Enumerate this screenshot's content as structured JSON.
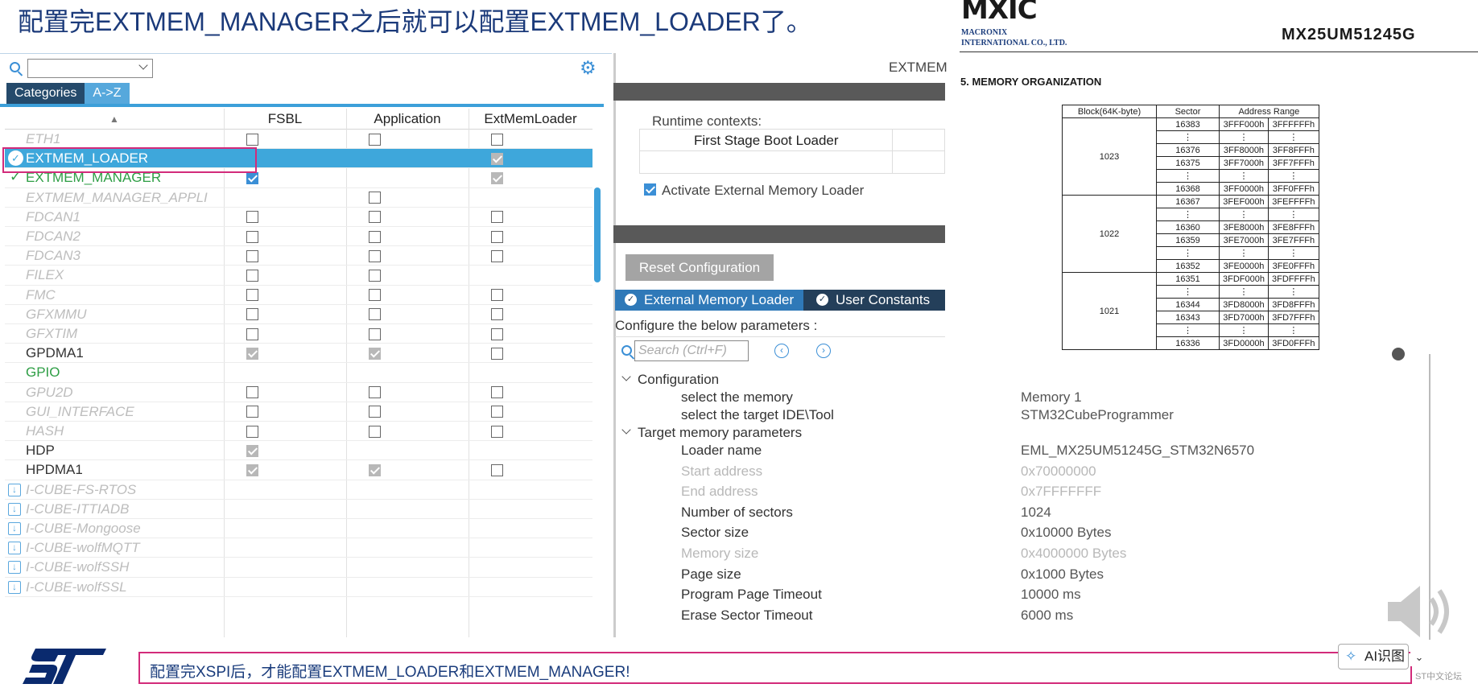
{
  "slide": {
    "title": "配置完EXTMEM_MANAGER之后就可以配置EXTMEM_LOADER了。",
    "footer_note": "配置完XSPI后，才能配置EXTMEM_LOADER和EXTMEM_MANAGER!"
  },
  "left_panel": {
    "search_value": "",
    "tabs": [
      "Categories",
      "A->Z"
    ],
    "active_tab": "A->Z",
    "columns": [
      "FSBL",
      "Application",
      "ExtMemLoader"
    ],
    "rows": [
      {
        "name": "ETH1",
        "state": "disabled",
        "fsbl": "off",
        "app": "off",
        "eml": "off"
      },
      {
        "name": "EXTMEM_LOADER",
        "state": "selected",
        "fsbl": "none",
        "app": "none",
        "eml": "locked"
      },
      {
        "name": "EXTMEM_MANAGER",
        "state": "ok",
        "fsbl": "on",
        "app": "none",
        "eml": "locked"
      },
      {
        "name": "EXTMEM_MANAGER_APPLI",
        "state": "disabled",
        "fsbl": "none",
        "app": "off",
        "eml": "none"
      },
      {
        "name": "FDCAN1",
        "state": "disabled",
        "fsbl": "off",
        "app": "off",
        "eml": "off"
      },
      {
        "name": "FDCAN2",
        "state": "disabled",
        "fsbl": "off",
        "app": "off",
        "eml": "off"
      },
      {
        "name": "FDCAN3",
        "state": "disabled",
        "fsbl": "off",
        "app": "off",
        "eml": "off"
      },
      {
        "name": "FILEX",
        "state": "disabled",
        "fsbl": "off",
        "app": "off",
        "eml": "none"
      },
      {
        "name": "FMC",
        "state": "disabled",
        "fsbl": "off",
        "app": "off",
        "eml": "off"
      },
      {
        "name": "GFXMMU",
        "state": "disabled",
        "fsbl": "off",
        "app": "off",
        "eml": "off"
      },
      {
        "name": "GFXTIM",
        "state": "disabled",
        "fsbl": "off",
        "app": "off",
        "eml": "off"
      },
      {
        "name": "GPDMA1",
        "state": "enabled",
        "fsbl": "locked",
        "app": "locked",
        "eml": "off"
      },
      {
        "name": "GPIO",
        "state": "ok-text",
        "fsbl": "none",
        "app": "none",
        "eml": "none"
      },
      {
        "name": "GPU2D",
        "state": "disabled",
        "fsbl": "off",
        "app": "off",
        "eml": "off"
      },
      {
        "name": "GUI_INTERFACE",
        "state": "disabled",
        "fsbl": "off",
        "app": "off",
        "eml": "off"
      },
      {
        "name": "HASH",
        "state": "disabled",
        "fsbl": "off",
        "app": "off",
        "eml": "off"
      },
      {
        "name": "HDP",
        "state": "enabled",
        "fsbl": "locked",
        "app": "none",
        "eml": "none"
      },
      {
        "name": "HPDMA1",
        "state": "enabled",
        "fsbl": "locked",
        "app": "locked",
        "eml": "off"
      },
      {
        "name": "I-CUBE-FS-RTOS",
        "state": "pack",
        "fsbl": "none",
        "app": "none",
        "eml": "none"
      },
      {
        "name": "I-CUBE-ITTIADB",
        "state": "pack",
        "fsbl": "none",
        "app": "none",
        "eml": "none"
      },
      {
        "name": "I-CUBE-Mongoose",
        "state": "pack",
        "fsbl": "none",
        "app": "none",
        "eml": "none"
      },
      {
        "name": "I-CUBE-wolfMQTT",
        "state": "pack",
        "fsbl": "none",
        "app": "none",
        "eml": "none"
      },
      {
        "name": "I-CUBE-wolfSSH",
        "state": "pack",
        "fsbl": "none",
        "app": "none",
        "eml": "none"
      },
      {
        "name": "I-CUBE-wolfSSL",
        "state": "pack",
        "fsbl": "none",
        "app": "none",
        "eml": "none"
      }
    ]
  },
  "mid_panel": {
    "header": "EXTMEM",
    "runtime_label": "Runtime contexts:",
    "runtime_context": "First Stage Boot Loader",
    "activate_label": "Activate External Memory Loader",
    "activate_checked": true,
    "reset_button": "Reset Configuration",
    "tabs": [
      "External Memory Loader",
      "User Constants"
    ],
    "configure_note": "Configure the below parameters :",
    "search_placeholder": "Search (Ctrl+F)"
  },
  "params": {
    "groups": [
      {
        "label": "Configuration",
        "items": [
          {
            "label": "select the memory",
            "value": "Memory 1",
            "dim": false
          },
          {
            "label": "select the target IDE\\Tool",
            "value": "STM32CubeProgrammer",
            "dim": false
          }
        ]
      },
      {
        "label": "Target memory parameters",
        "items": [
          {
            "label": "Loader name",
            "value": "EML_MX25UM51245G_STM32N6570",
            "dim": false
          },
          {
            "label": "Start address",
            "value": "0x70000000",
            "dim": true
          },
          {
            "label": "End address",
            "value": "0x7FFFFFFF",
            "dim": true
          },
          {
            "label": "Number of sectors",
            "value": "1024",
            "dim": false
          },
          {
            "label": "Sector size",
            "value": "0x10000 Bytes",
            "dim": false
          },
          {
            "label": "Memory size",
            "value": "0x4000000 Bytes",
            "dim": true
          },
          {
            "label": "Page size",
            "value": "0x1000 Bytes",
            "dim": false
          },
          {
            "label": "Program Page Timeout",
            "value": "10000 ms",
            "dim": false
          },
          {
            "label": "Erase Sector Timeout",
            "value": "6000 ms",
            "dim": false
          }
        ]
      }
    ]
  },
  "datasheet": {
    "logo": "MXIC",
    "company_line1": "MACRONIX",
    "company_line2": "INTERNATIONAL CO., LTD.",
    "part_number": "MX25UM51245G",
    "section": "5. MEMORY ORGANIZATION",
    "headers": [
      "Block(64K-byte)",
      "Sector",
      "Address Range"
    ],
    "blocks": [
      {
        "block": "1023",
        "rows": [
          [
            "16383",
            "3FFF000h",
            "3FFFFFFh"
          ],
          [
            "⋮",
            "⋮",
            "⋮"
          ],
          [
            "16376",
            "3FF8000h",
            "3FF8FFFh"
          ],
          [
            "16375",
            "3FF7000h",
            "3FF7FFFh"
          ],
          [
            "⋮",
            "⋮",
            "⋮"
          ],
          [
            "16368",
            "3FF0000h",
            "3FF0FFFh"
          ]
        ]
      },
      {
        "block": "1022",
        "rows": [
          [
            "16367",
            "3FEF000h",
            "3FEFFFFh"
          ],
          [
            "⋮",
            "⋮",
            "⋮"
          ],
          [
            "16360",
            "3FE8000h",
            "3FE8FFFh"
          ],
          [
            "16359",
            "3FE7000h",
            "3FE7FFFh"
          ],
          [
            "⋮",
            "⋮",
            "⋮"
          ],
          [
            "16352",
            "3FE0000h",
            "3FE0FFFh"
          ]
        ]
      },
      {
        "block": "1021",
        "rows": [
          [
            "16351",
            "3FDF000h",
            "3FDFFFFh"
          ],
          [
            "⋮",
            "⋮",
            "⋮"
          ],
          [
            "16344",
            "3FD8000h",
            "3FD8FFFh"
          ],
          [
            "16343",
            "3FD7000h",
            "3FD7FFFh"
          ],
          [
            "⋮",
            "⋮",
            "⋮"
          ],
          [
            "16336",
            "3FD0000h",
            "3FD0FFFh"
          ]
        ]
      }
    ]
  },
  "overlay": {
    "ai_button": "AI识图",
    "footnote": "ST中文论坛"
  },
  "colors": {
    "selection": "#3ea7db",
    "ok_green": "#2e9e45",
    "highlight_frame": "#d22b7a",
    "tab_dark": "#243f5a",
    "accent_blue": "#3b8fd6"
  }
}
